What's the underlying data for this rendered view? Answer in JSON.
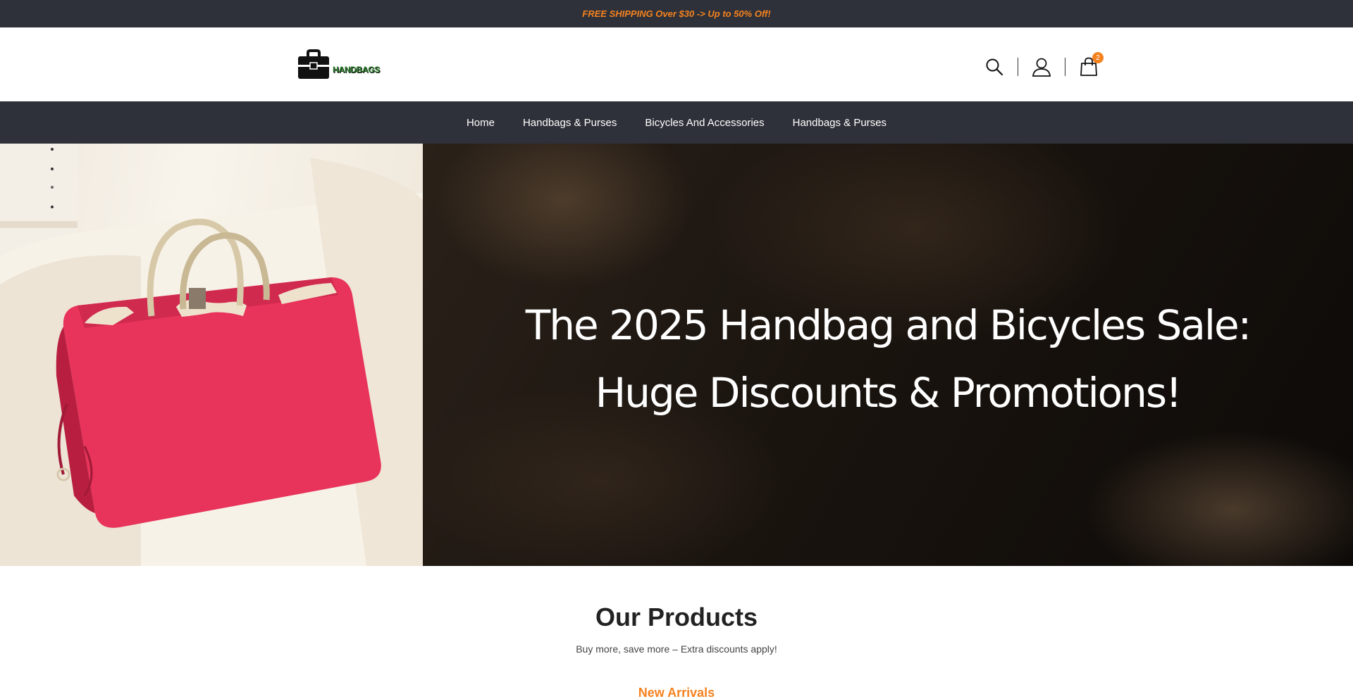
{
  "topbar": {
    "promo": "FREE SHIPPING Over $30 -> Up to 50% Off!"
  },
  "header": {
    "logo_text": "HANDBAGS",
    "icons": [
      "search-icon",
      "user-icon",
      "cart-icon"
    ],
    "cart_count": "2"
  },
  "nav": {
    "items": [
      {
        "label": "Home"
      },
      {
        "label": "Handbags & Purses"
      },
      {
        "label": "Bicycles And Accessories"
      },
      {
        "label": "Handbags & Purses"
      }
    ]
  },
  "hero": {
    "line1": "The 2025 Handbag and Bicycles Sale:",
    "line2": "Huge Discounts & Promotions!"
  },
  "products": {
    "title": "Our Products",
    "subtitle": "Buy more, save more – Extra discounts apply!",
    "tab": "New Arrivals"
  },
  "colors": {
    "accent": "#f5821f",
    "dark": "#2e3139",
    "bag": "#e8335a"
  }
}
